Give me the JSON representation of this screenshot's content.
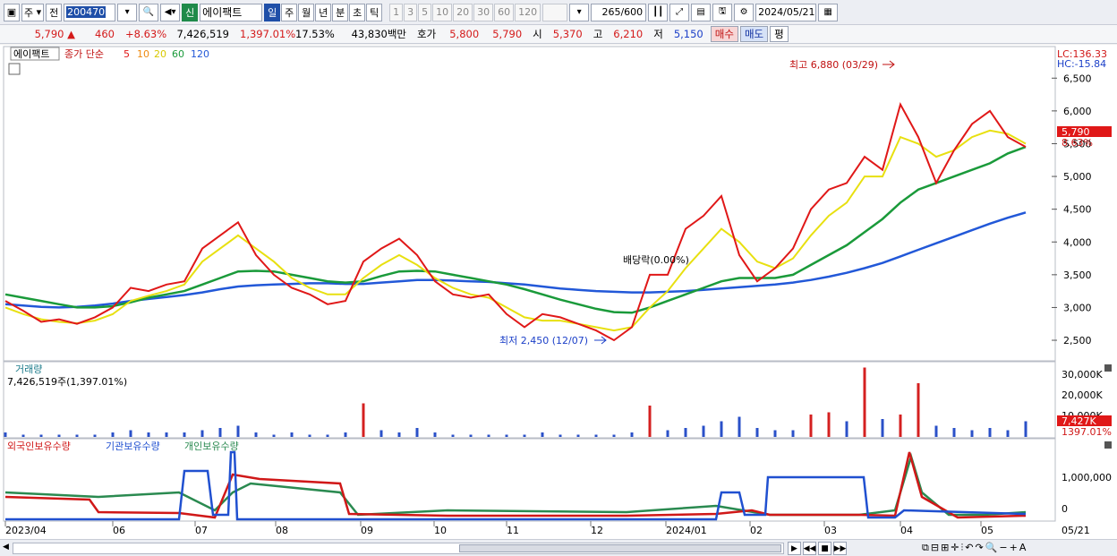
{
  "toolbar": {
    "period_type": "주",
    "prev_label": "전",
    "code": "200470",
    "credit_label": "신",
    "stock_name": "에이팩트",
    "periods": [
      "일",
      "주",
      "월",
      "년",
      "분",
      "초",
      "틱"
    ],
    "active_period": "일",
    "intervals": [
      "1",
      "3",
      "5",
      "10",
      "20",
      "30",
      "60",
      "120"
    ],
    "count": "265",
    "count_max": "/600",
    "date": "2024/05/21"
  },
  "info": {
    "price": "5,790",
    "change": "460",
    "rate": "+8.63%",
    "volume": "7,426,519",
    "vol_ratio": "1,397.01%",
    "turnover": "17.53%",
    "amount": "43,830백만",
    "ask_label": "호가",
    "ask": "5,800",
    "bid": "5,790",
    "open_label": "시",
    "open": "5,370",
    "high_label": "고",
    "high": "6,210",
    "low_label": "저",
    "low": "5,150",
    "buy_label": "매수",
    "sell_label": "매도",
    "eval_label": "평"
  },
  "legend": {
    "name": "에이팩트",
    "prefix": "종가 단순",
    "ma": [
      {
        "label": "5",
        "color": "#e01818"
      },
      {
        "label": "10",
        "color": "#ee8a10"
      },
      {
        "label": "20",
        "color": "#e8e010"
      },
      {
        "label": "60",
        "color": "#1a9a3a"
      },
      {
        "label": "120",
        "color": "#2258d8"
      }
    ]
  },
  "price_axis": {
    "ticks": [
      {
        "label": "6,500",
        "value": 6500
      },
      {
        "label": "6,000",
        "value": 6000
      },
      {
        "label": "5,500",
        "value": 5500
      },
      {
        "label": "5,000",
        "value": 5000
      },
      {
        "label": "4,500",
        "value": 4500
      },
      {
        "label": "4,000",
        "value": 4000
      },
      {
        "label": "3,500",
        "value": 3500
      },
      {
        "label": "3,000",
        "value": 3000
      },
      {
        "label": "2,500",
        "value": 2500
      }
    ],
    "lc": "LC:136.33",
    "hc": "HC:-15.84",
    "current_price": "5,790",
    "current_rate": "8.63%"
  },
  "annotations": {
    "high": "최고 6,880 (03/29)",
    "low": "최저 2,450 (12/07)",
    "dividend": "배당락(0.00%)"
  },
  "volume_panel": {
    "title": "거래량",
    "value": "7,426,519주(1,397.01%)",
    "ticks": [
      "30,000K",
      "20,000K",
      "10,000K"
    ],
    "current": "7,427K",
    "current_rate": "1397.01%"
  },
  "holders_panel": {
    "series": [
      {
        "name": "외국인보유수량",
        "color": "#d01818"
      },
      {
        "name": "기관보유수량",
        "color": "#2050d0"
      },
      {
        "name": "개인보유수량",
        "color": "#2a8a50"
      }
    ],
    "ticks": [
      "1,000,000",
      "0"
    ]
  },
  "x_axis": [
    "2023/04",
    "06",
    "07",
    "08",
    "09",
    "10",
    "11",
    "12",
    "2024/01",
    "02",
    "03",
    "04",
    "05"
  ],
  "x_axis_right": "05/21",
  "chart_data": {
    "type": "line",
    "ylim": [
      2200,
      6900
    ],
    "ma5": [
      3100,
      2950,
      2780,
      2820,
      2750,
      2850,
      3000,
      3300,
      3250,
      3350,
      3400,
      3900,
      4100,
      4300,
      3800,
      3500,
      3300,
      3200,
      3050,
      3100,
      3700,
      3900,
      4050,
      3800,
      3400,
      3200,
      3150,
      3200,
      2900,
      2700,
      2900,
      2850,
      2750,
      2650,
      2500,
      2700,
      3500,
      3500,
      4200,
      4400,
      4700,
      3800,
      3400,
      3600,
      3900,
      4500,
      4800,
      4900,
      5300,
      5100,
      6100,
      5600,
      4900,
      5400,
      5800,
      6000,
      5600,
      5450
    ],
    "ma20": [
      3000,
      2900,
      2820,
      2780,
      2760,
      2800,
      2900,
      3100,
      3180,
      3250,
      3350,
      3700,
      3900,
      4100,
      3900,
      3700,
      3450,
      3300,
      3200,
      3200,
      3450,
      3650,
      3800,
      3650,
      3450,
      3300,
      3200,
      3150,
      3000,
      2850,
      2800,
      2800,
      2750,
      2700,
      2650,
      2700,
      3000,
      3250,
      3600,
      3900,
      4200,
      4000,
      3700,
      3600,
      3750,
      4100,
      4400,
      4600,
      5000,
      5000,
      5600,
      5500,
      5300,
      5400,
      5600,
      5700,
      5650,
      5500
    ],
    "ma60": [
      3200,
      3150,
      3100,
      3050,
      3000,
      3000,
      3020,
      3080,
      3150,
      3200,
      3250,
      3350,
      3450,
      3550,
      3560,
      3550,
      3500,
      3450,
      3400,
      3380,
      3400,
      3480,
      3550,
      3560,
      3550,
      3500,
      3450,
      3400,
      3350,
      3280,
      3200,
      3120,
      3050,
      2980,
      2930,
      2920,
      3000,
      3100,
      3200,
      3300,
      3400,
      3450,
      3450,
      3450,
      3500,
      3650,
      3800,
      3950,
      4150,
      4350,
      4600,
      4800,
      4900,
      5000,
      5100,
      5200,
      5350,
      5450
    ],
    "ma120": [
      3050,
      3030,
      3010,
      3000,
      3010,
      3030,
      3060,
      3100,
      3130,
      3160,
      3190,
      3230,
      3280,
      3320,
      3340,
      3350,
      3360,
      3370,
      3370,
      3360,
      3360,
      3380,
      3400,
      3420,
      3420,
      3410,
      3400,
      3390,
      3370,
      3350,
      3320,
      3290,
      3270,
      3250,
      3240,
      3230,
      3230,
      3240,
      3250,
      3270,
      3290,
      3310,
      3330,
      3350,
      3380,
      3420,
      3470,
      3530,
      3600,
      3680,
      3780,
      3880,
      3980,
      4080,
      4180,
      4280,
      4370,
      4450
    ],
    "volume": [
      2,
      1,
      1,
      1,
      1,
      1,
      2,
      3,
      2,
      2,
      2,
      3,
      4,
      5,
      2,
      1,
      2,
      1,
      1,
      2,
      15,
      3,
      2,
      4,
      2,
      1,
      1,
      1,
      1,
      1,
      2,
      1,
      1,
      1,
      1,
      2,
      14,
      3,
      4,
      5,
      7,
      9,
      4,
      3,
      3,
      10,
      11,
      7,
      31,
      8,
      10,
      24,
      5,
      4,
      3,
      4,
      3,
      7
    ]
  }
}
